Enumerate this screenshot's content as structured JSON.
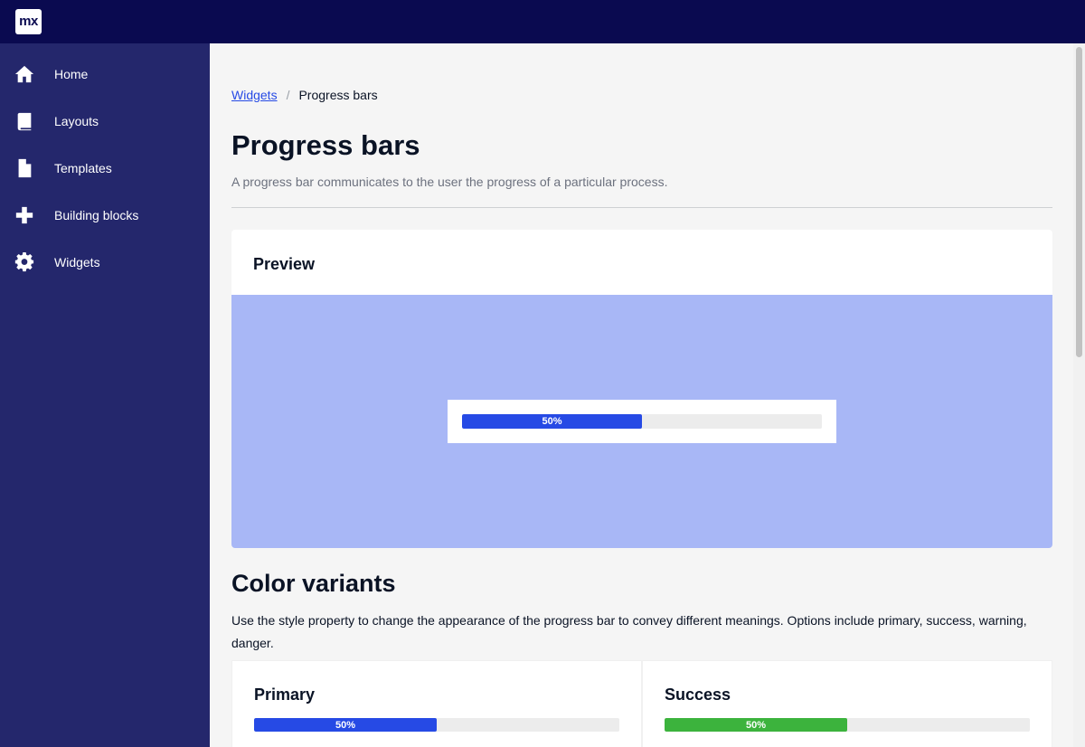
{
  "app": {
    "logo_text": "mx"
  },
  "colors": {
    "topbar": "#0a0a50",
    "sidebar": "#24276c",
    "primary": "#264ae5",
    "success": "#3cb33d",
    "preview_bg": "#a8b7f6"
  },
  "sidebar": {
    "items": [
      {
        "label": "Home",
        "icon": "home-icon"
      },
      {
        "label": "Layouts",
        "icon": "book-icon"
      },
      {
        "label": "Templates",
        "icon": "file-icon"
      },
      {
        "label": "Building blocks",
        "icon": "plus-icon"
      },
      {
        "label": "Widgets",
        "icon": "gear-icon"
      }
    ]
  },
  "breadcrumb": {
    "link": "Widgets",
    "separator": "/",
    "current": "Progress bars"
  },
  "page": {
    "title": "Progress bars",
    "description": "A progress bar communicates to the user the progress of a particular process."
  },
  "preview": {
    "title": "Preview",
    "progress_value": 0.5,
    "progress_label": "50%"
  },
  "color_variants": {
    "title": "Color variants",
    "description": "Use the style property to change the appearance of the progress bar to convey different meanings. Options include primary, success, warning, danger.",
    "variants": [
      {
        "title": "Primary",
        "progress_value": 0.5,
        "progress_label": "50%",
        "color": "#264ae5"
      },
      {
        "title": "Success",
        "progress_value": 0.5,
        "progress_label": "50%",
        "color": "#3cb33d"
      }
    ]
  }
}
